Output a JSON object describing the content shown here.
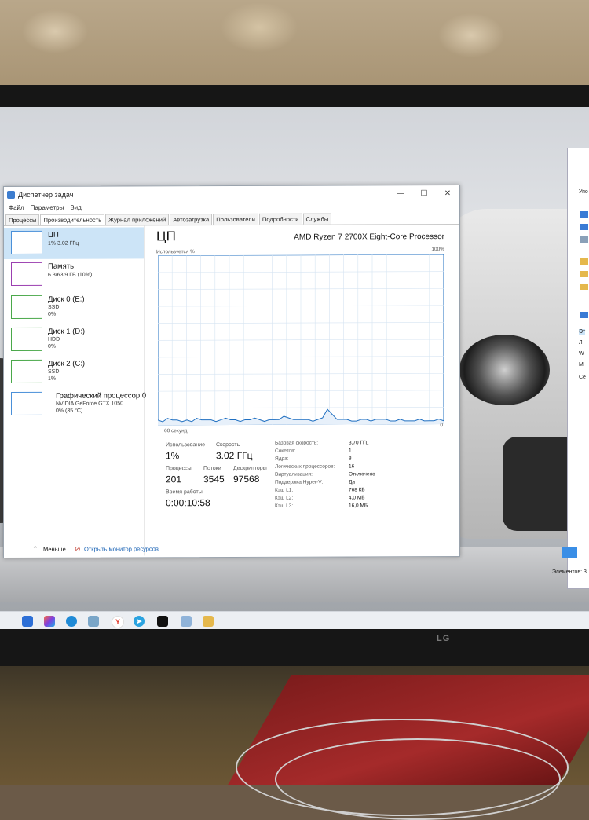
{
  "window": {
    "title": "Диспетчер задач",
    "minimize_glyph": "—",
    "maximize_glyph": "☐",
    "close_glyph": "✕"
  },
  "menu": [
    "Файл",
    "Параметры",
    "Вид"
  ],
  "tabs": [
    {
      "label": "Процессы",
      "active": false
    },
    {
      "label": "Производительность",
      "active": true
    },
    {
      "label": "Журнал приложений",
      "active": false
    },
    {
      "label": "Автозагрузка",
      "active": false
    },
    {
      "label": "Пользователи",
      "active": false
    },
    {
      "label": "Подробности",
      "active": false
    },
    {
      "label": "Службы",
      "active": false
    }
  ],
  "sidebar": [
    {
      "title": "ЦП",
      "lines": [
        "1% 3.02 ГГц"
      ],
      "kind": "cpu"
    },
    {
      "title": "Память",
      "lines": [
        "6.3/63.9 ГБ (10%)"
      ],
      "kind": "mem"
    },
    {
      "title": "Диск 0 (E:)",
      "lines": [
        "SSD",
        "0%"
      ],
      "kind": "disk"
    },
    {
      "title": "Диск 1 (D:)",
      "lines": [
        "HDD",
        "0%"
      ],
      "kind": "disk"
    },
    {
      "title": "Диск 2 (C:)",
      "lines": [
        "SSD",
        "1%"
      ],
      "kind": "disk"
    },
    {
      "title": "Графический процессор 0",
      "lines": [
        "NVIDIA GeForce GTX 1050",
        "0% (35 °C)"
      ],
      "kind": "gpu"
    }
  ],
  "main": {
    "heading": "ЦП",
    "model": "AMD Ryzen 7 2700X Eight-Core Processor",
    "graph_label": "Используется %",
    "graph_max": "100%",
    "graph_time": "60 секунд",
    "graph_min": "0",
    "usage_label": "Использование",
    "usage_value": "1%",
    "speed_label": "Скорость",
    "speed_value": "3.02 ГГц",
    "processes_label": "Процессы",
    "processes_value": "201",
    "threads_label": "Потоки",
    "threads_value": "3545",
    "handles_label": "Дескрипторы",
    "handles_value": "97568",
    "uptime_label": "Время работы",
    "uptime_value": "0:00:10:58",
    "details": [
      {
        "key": "Базовая скорость:",
        "value": "3,70 ГГц"
      },
      {
        "key": "Сокетов:",
        "value": "1"
      },
      {
        "key": "Ядра:",
        "value": "8"
      },
      {
        "key": "Логических процессоров:",
        "value": "16"
      },
      {
        "key": "Виртуализация:",
        "value": "Отключено"
      },
      {
        "key": "Поддержка Hyper-V:",
        "value": "Да"
      },
      {
        "key": "Кэш L1:",
        "value": "768 КБ"
      },
      {
        "key": "Кэш L2:",
        "value": "4,0 МБ"
      },
      {
        "key": "Кэш L3:",
        "value": "16,0 МБ"
      }
    ]
  },
  "cpu_graph_values": [
    3,
    2,
    4,
    3,
    3,
    2,
    3,
    2,
    4,
    3,
    3,
    3,
    2,
    3,
    4,
    3,
    3,
    2,
    3,
    3,
    4,
    3,
    2,
    3,
    3,
    3,
    5,
    4,
    3,
    3,
    3,
    3,
    2,
    3,
    4,
    9,
    6,
    3,
    3,
    3,
    2,
    2,
    3,
    3,
    2,
    3,
    3,
    3,
    2,
    2,
    3,
    2,
    2,
    2,
    3,
    2,
    2,
    2,
    3,
    2
  ],
  "footer": {
    "fewer_label": "Меньше",
    "resmon_label": "Открыть монитор ресурсов"
  },
  "explorer": {
    "lines": [
      "Упо",
      "Эт",
      "Л",
      "W",
      "M",
      "Се",
      "Элементов: 3"
    ]
  },
  "monitor_brand": "LG",
  "colors": {
    "cpu_line": "#1f6fc1",
    "cpu_fill": "#e7f0fa",
    "grid": "#d6e4f2",
    "selected": "#cce4f7"
  },
  "taskbar_icons": [
    "windows-start-icon",
    "task-view-icon",
    "copilot-icon",
    "edge-icon",
    "photos-icon",
    "yandex-icon",
    "telegram-icon",
    "app-icon",
    "explorer-icon",
    "folder-icon"
  ]
}
